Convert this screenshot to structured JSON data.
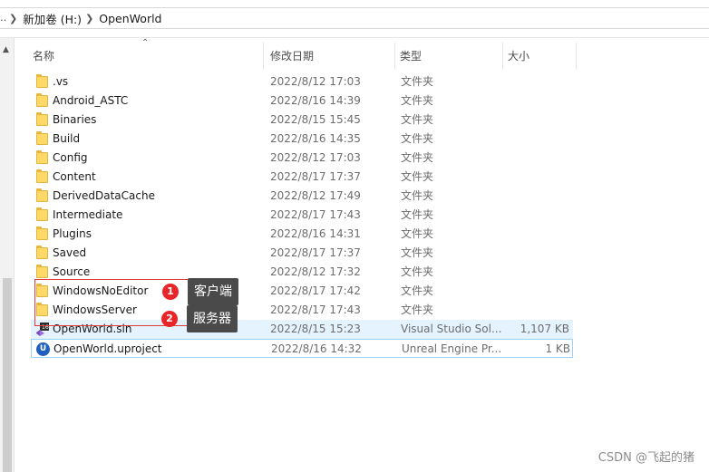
{
  "address": {
    "edge_glyph": "…",
    "crumbs": [
      "新加卷 (H:)",
      "OpenWorld"
    ]
  },
  "columns": {
    "name": "名称",
    "date": "修改日期",
    "type": "类型",
    "size": "大小"
  },
  "files": [
    {
      "name": ".vs",
      "date": "2022/8/12 17:03",
      "type": "文件夹",
      "size": "",
      "icon": "folder-icon"
    },
    {
      "name": "Android_ASTC",
      "date": "2022/8/16 14:39",
      "type": "文件夹",
      "size": "",
      "icon": "folder-icon"
    },
    {
      "name": "Binaries",
      "date": "2022/8/15 15:45",
      "type": "文件夹",
      "size": "",
      "icon": "folder-icon"
    },
    {
      "name": "Build",
      "date": "2022/8/16 14:35",
      "type": "文件夹",
      "size": "",
      "icon": "folder-icon"
    },
    {
      "name": "Config",
      "date": "2022/8/12 17:03",
      "type": "文件夹",
      "size": "",
      "icon": "folder-icon"
    },
    {
      "name": "Content",
      "date": "2022/8/17 17:37",
      "type": "文件夹",
      "size": "",
      "icon": "folder-icon"
    },
    {
      "name": "DerivedDataCache",
      "date": "2022/8/12 17:49",
      "type": "文件夹",
      "size": "",
      "icon": "folder-icon"
    },
    {
      "name": "Intermediate",
      "date": "2022/8/17 17:43",
      "type": "文件夹",
      "size": "",
      "icon": "folder-icon"
    },
    {
      "name": "Plugins",
      "date": "2022/8/16 14:31",
      "type": "文件夹",
      "size": "",
      "icon": "folder-icon"
    },
    {
      "name": "Saved",
      "date": "2022/8/17 17:37",
      "type": "文件夹",
      "size": "",
      "icon": "folder-icon"
    },
    {
      "name": "Source",
      "date": "2022/8/12 17:32",
      "type": "文件夹",
      "size": "",
      "icon": "folder-icon"
    },
    {
      "name": "WindowsNoEditor",
      "date": "2022/8/17 17:42",
      "type": "文件夹",
      "size": "",
      "icon": "folder-icon"
    },
    {
      "name": "WindowsServer",
      "date": "2022/8/17 17:43",
      "type": "文件夹",
      "size": "",
      "icon": "folder-icon"
    },
    {
      "name": "OpenWorld.sln",
      "date": "2022/8/15 15:23",
      "type": "Visual Studio Sol...",
      "size": "1,107 KB",
      "icon": "visual-studio-solution-icon"
    },
    {
      "name": "OpenWorld.uproject",
      "date": "2022/8/16 14:32",
      "type": "Unreal Engine Pr...",
      "size": "1 KB",
      "icon": "unreal-engine-icon"
    }
  ],
  "annotations": [
    {
      "number": "1",
      "label": "客户端"
    },
    {
      "number": "2",
      "label": "服务器"
    }
  ],
  "watermark": "CSDN @飞起的猪",
  "colors": {
    "selection": "#e5f3ff",
    "highlight_box": "#e23b3b",
    "badge": "#e8262a",
    "callout_bg": "#4a4a4a"
  }
}
